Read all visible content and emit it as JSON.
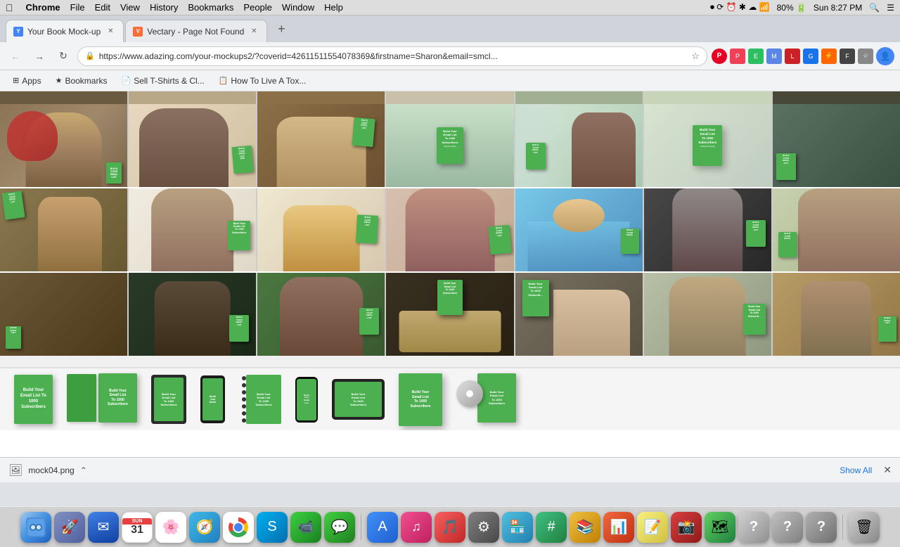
{
  "menubar": {
    "apple": "⌘",
    "items": [
      "Chrome",
      "File",
      "Edit",
      "View",
      "History",
      "Bookmarks",
      "People",
      "Window",
      "Help"
    ],
    "right": {
      "time": "Sun 8:27 PM",
      "battery": "80%",
      "wifi": "WiFi"
    }
  },
  "tabs": [
    {
      "id": "tab-1",
      "title": "Your Book Mock-up",
      "active": true,
      "url": "https://www.adazing.com/your-mockups2/?coverid=42611511554078369&firstname=Sharon&email=smcl..."
    },
    {
      "id": "tab-2",
      "title": "Vectary - Page Not Found",
      "active": false
    }
  ],
  "toolbar": {
    "address": "https://www.adazing.com/your-mockups2/?coverid=42611511554078369&firstname=Sharon&email=smcl..."
  },
  "bookmarks": [
    {
      "label": "Apps",
      "icon": "⊞"
    },
    {
      "label": "Bookmarks",
      "icon": "★"
    },
    {
      "label": "Sell T-Shirts & Cl...",
      "icon": "📄"
    },
    {
      "label": "How To Live A Tox...",
      "icon": "📋"
    }
  ],
  "download": {
    "filename": "mock04.png",
    "icon": "🖼",
    "show_all": "Show All"
  },
  "book_text": "Build Your\nEmail List\nTo 1000\nSubscribers\nStep by Step",
  "device_labels": {
    "book": "Build Your\nEmail List\nTo 1000\nSubscribers",
    "tablet": "Build Your\nEmail List\nTo 1000\nSubscribers",
    "phone": "Build",
    "spiral": "Build Your\nEmail List"
  },
  "dock_icons": [
    {
      "name": "finder",
      "label": "Finder",
      "color": "#a0c8f0",
      "symbol": "🔍"
    },
    {
      "name": "launchpad",
      "label": "Launchpad",
      "symbol": "🚀"
    },
    {
      "name": "mail",
      "label": "Mail",
      "symbol": "✉"
    },
    {
      "name": "calendar",
      "label": "Calendar",
      "symbol": "📅"
    },
    {
      "name": "photos",
      "label": "Photos",
      "symbol": "📷"
    },
    {
      "name": "safari",
      "label": "Safari",
      "symbol": "🧭"
    },
    {
      "name": "chrome",
      "label": "Chrome",
      "symbol": "◉"
    },
    {
      "name": "skype",
      "label": "Skype",
      "symbol": "💬"
    },
    {
      "name": "facetime",
      "label": "FaceTime",
      "symbol": "📹"
    },
    {
      "name": "messages",
      "label": "Messages",
      "symbol": "💬"
    },
    {
      "name": "appstore",
      "label": "App Store",
      "symbol": "A"
    },
    {
      "name": "itunes",
      "label": "iTunes",
      "symbol": "♪"
    },
    {
      "name": "music",
      "label": "Music",
      "symbol": "🎵"
    },
    {
      "name": "systemprefs",
      "label": "System Preferences",
      "symbol": "⚙"
    },
    {
      "name": "browser2",
      "label": "Browser",
      "symbol": "🌐"
    },
    {
      "name": "numbers",
      "label": "Numbers",
      "symbol": "#"
    },
    {
      "name": "ibooks",
      "label": "iBooks",
      "symbol": "📚"
    },
    {
      "name": "activities",
      "label": "Activity Monitor",
      "symbol": "📊"
    },
    {
      "name": "notes",
      "label": "Notes",
      "symbol": "📝"
    },
    {
      "name": "photobooth",
      "label": "Photo Booth",
      "symbol": "📸"
    },
    {
      "name": "maps",
      "label": "Maps",
      "symbol": "🗺"
    },
    {
      "name": "help1",
      "label": "Help",
      "symbol": "?"
    },
    {
      "name": "help2",
      "label": "Help",
      "symbol": "?"
    },
    {
      "name": "help3",
      "label": "Help",
      "symbol": "?"
    },
    {
      "name": "trash",
      "label": "Trash",
      "symbol": "🗑"
    }
  ]
}
